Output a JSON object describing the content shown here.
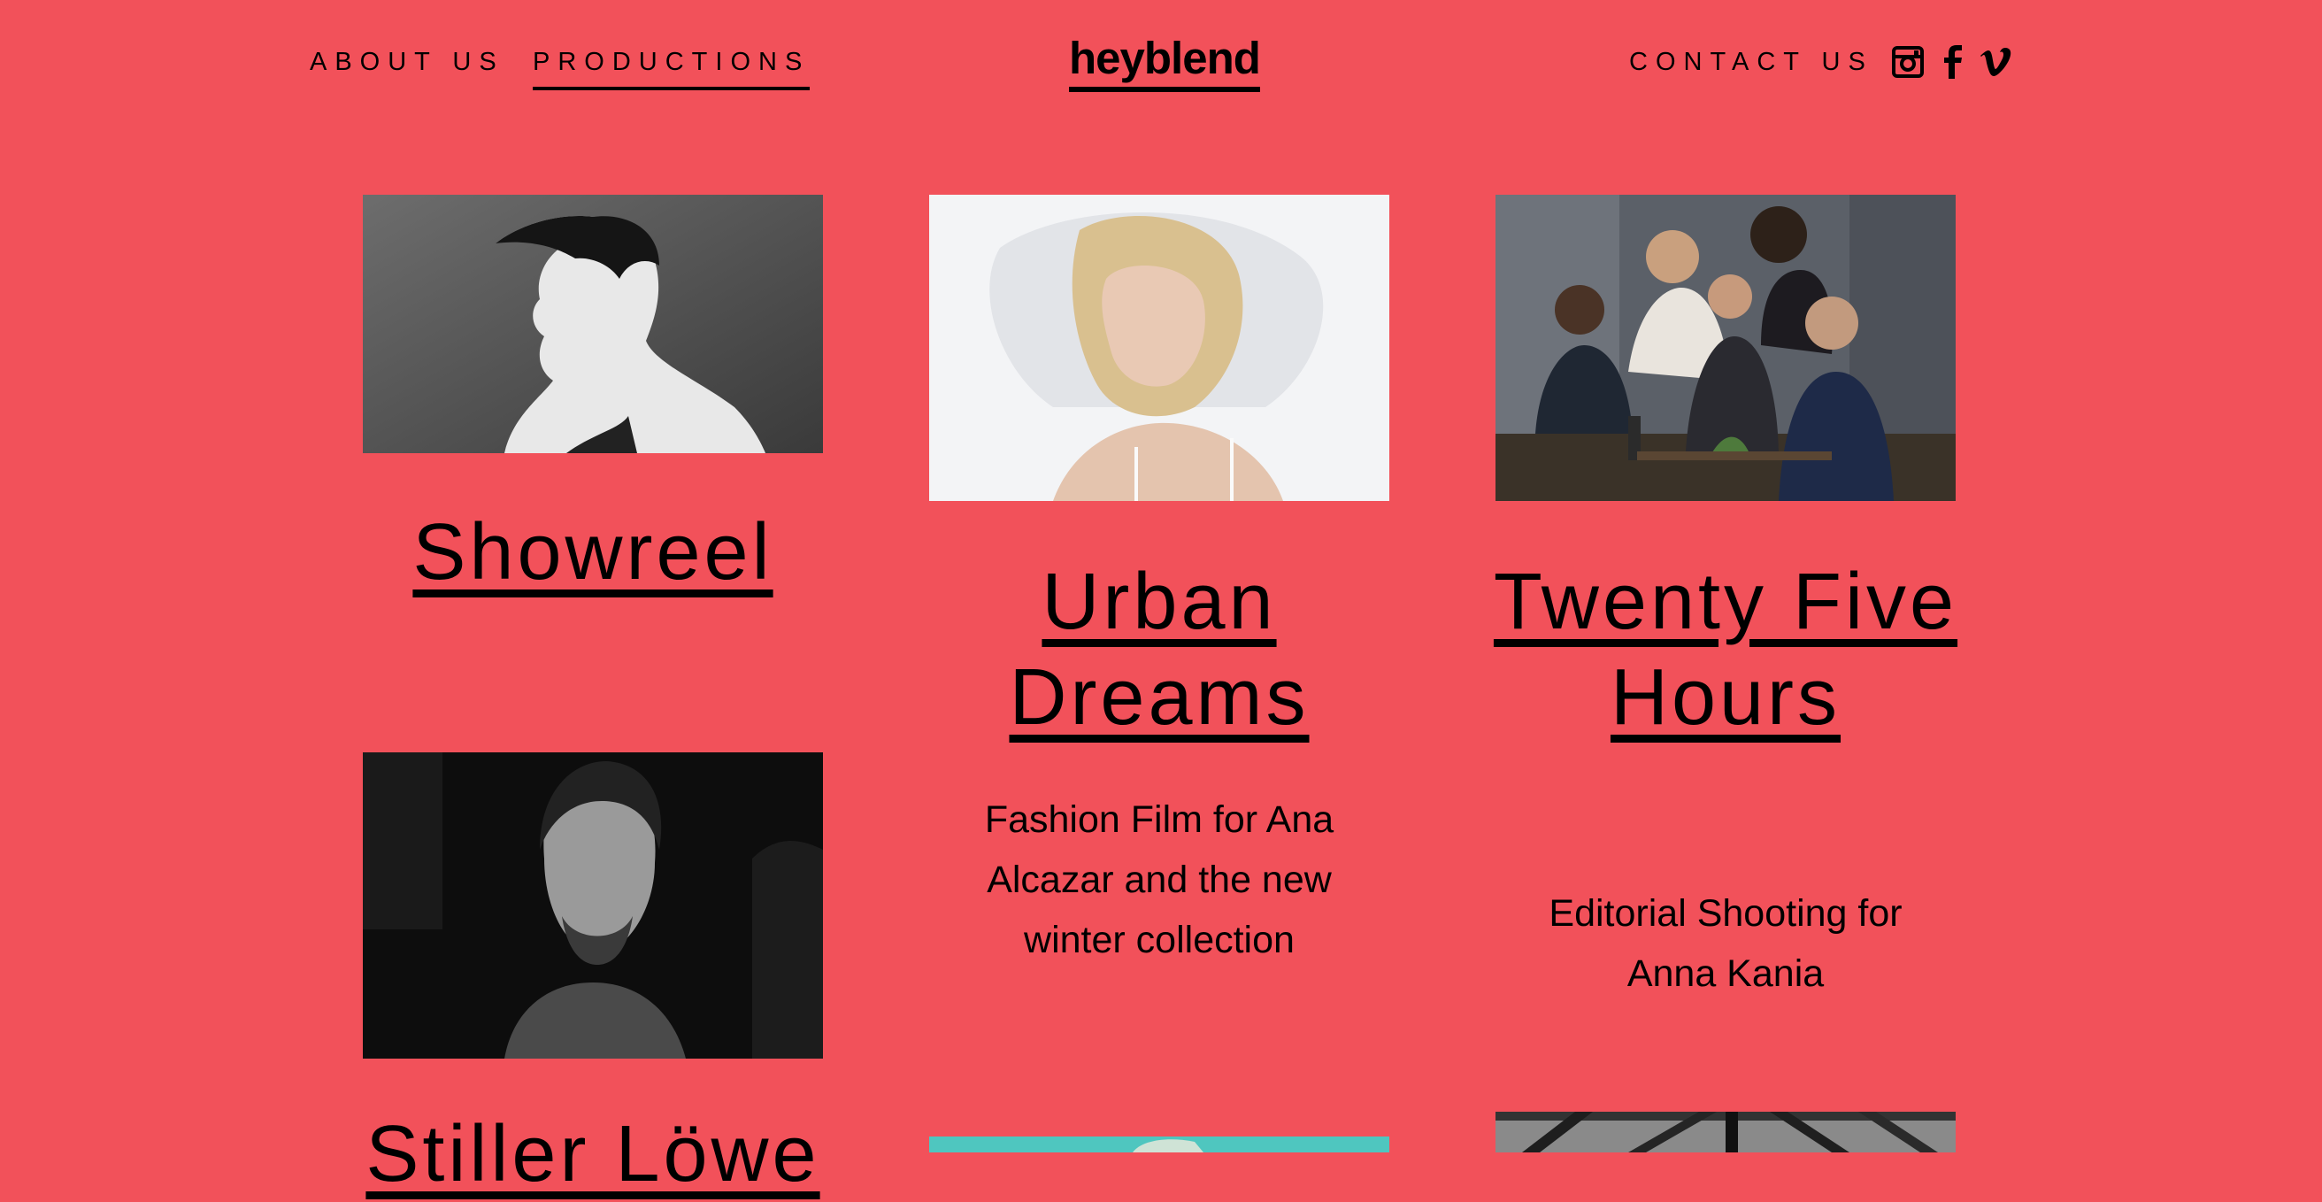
{
  "header": {
    "nav_left": [
      {
        "label": "ABOUT US",
        "active": false
      },
      {
        "label": "PRODUCTIONS",
        "active": true
      }
    ],
    "logo": "heyblend",
    "nav_right": {
      "label": "CONTACT US"
    },
    "social": [
      {
        "icon": "instagram-icon"
      },
      {
        "icon": "facebook-icon"
      },
      {
        "icon": "vimeo-icon"
      }
    ]
  },
  "productions": [
    {
      "title": "Showreel",
      "description": "",
      "image": "bw-profile-man"
    },
    {
      "title": "Urban Dreams",
      "description": "Fashion Film for Ana Alcazar and the new winter collection",
      "image": "blonde-woman-pillow"
    },
    {
      "title": "Twenty Five Hours",
      "description": "Editorial Shooting for Anna Kania",
      "image": "group-dinner"
    },
    {
      "title": "Stiller Löwe",
      "description": "",
      "image": "bw-portrait-man"
    },
    {
      "title": "",
      "description": "",
      "image": "teal-partial"
    },
    {
      "title": "",
      "description": "",
      "image": "bw-structure-partial"
    }
  ],
  "colors": {
    "background": "#f2515a",
    "text": "#000000"
  }
}
